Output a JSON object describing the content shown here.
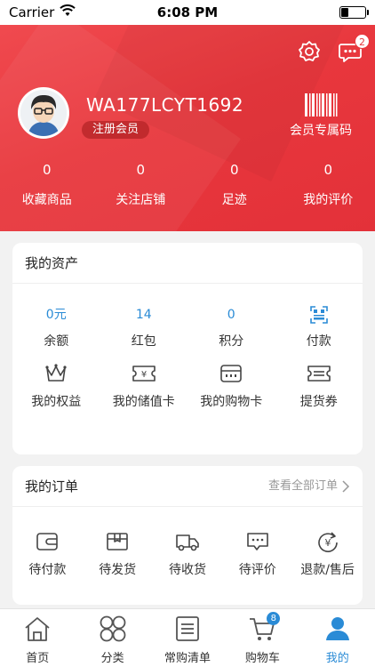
{
  "status_bar": {
    "carrier": "Carrier",
    "time": "6:08 PM"
  },
  "header": {
    "message_count": "2",
    "username": "WA177LCYT1692",
    "member_level": "注册会员",
    "member_code_label": "会员专属码",
    "stats": [
      {
        "value": "0",
        "label": "收藏商品"
      },
      {
        "value": "0",
        "label": "关注店铺"
      },
      {
        "value": "0",
        "label": "足迹"
      },
      {
        "value": "0",
        "label": "我的评价"
      }
    ]
  },
  "assets": {
    "title": "我的资产",
    "row1": [
      {
        "value": "0元",
        "label": "余额"
      },
      {
        "value": "14",
        "label": "红包"
      },
      {
        "value": "0",
        "label": "积分"
      },
      {
        "icon": "payment-code-icon",
        "label": "付款"
      }
    ],
    "row2": [
      {
        "icon": "crown-icon",
        "label": "我的权益"
      },
      {
        "icon": "yen-card-icon",
        "label": "我的储值卡"
      },
      {
        "icon": "shopping-card-icon",
        "label": "我的购物卡"
      },
      {
        "icon": "voucher-icon",
        "label": "提货券"
      }
    ]
  },
  "orders": {
    "title": "我的订单",
    "view_all": "查看全部订单",
    "items": [
      {
        "icon": "wallet-icon",
        "label": "待付款"
      },
      {
        "icon": "package-icon",
        "label": "待发货"
      },
      {
        "icon": "truck-icon",
        "label": "待收货"
      },
      {
        "icon": "comment-icon",
        "label": "待评价"
      },
      {
        "icon": "refund-icon",
        "label": "退款/售后"
      }
    ]
  },
  "tabbar": {
    "cart_count": "8",
    "tabs": [
      {
        "icon": "home-icon",
        "label": "首页"
      },
      {
        "icon": "category-icon",
        "label": "分类"
      },
      {
        "icon": "list-icon",
        "label": "常购清单"
      },
      {
        "icon": "cart-icon",
        "label": "购物车"
      },
      {
        "icon": "user-icon",
        "label": "我的"
      }
    ],
    "active_tab": "我的"
  },
  "colors": {
    "brand_red": "#e8373d",
    "accent_blue": "#2a8bd6"
  }
}
